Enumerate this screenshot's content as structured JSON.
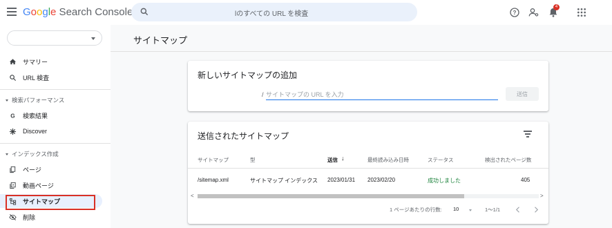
{
  "app": {
    "logo_word": "Google",
    "logo_rest": " Search Console"
  },
  "search": {
    "placeholder": "lのすべての URL を検査"
  },
  "header": {
    "notification_count": "4",
    "icons": [
      "help-icon",
      "manage-accounts-icon",
      "notifications-icon",
      "apps-icon"
    ]
  },
  "sidebar": {
    "property": "",
    "items": [
      {
        "label": "サマリー",
        "icon": "home-icon"
      },
      {
        "label": "URL 検査",
        "icon": "search-icon"
      },
      {
        "label": "検索結果",
        "icon": "google-g-icon"
      },
      {
        "label": "Discover",
        "icon": "discover-icon"
      },
      {
        "label": "ページ",
        "icon": "pages-icon"
      },
      {
        "label": "動画ページ",
        "icon": "video-pages-icon"
      },
      {
        "label": "サイトマップ",
        "icon": "sitemap-icon"
      },
      {
        "label": "削除",
        "icon": "removals-icon"
      }
    ],
    "sections": [
      "検索パフォーマンス",
      "インデックス作成"
    ]
  },
  "main": {
    "page_title": "サイトマップ",
    "add_card": {
      "title": "新しいサイトマップの追加",
      "prefix": "/",
      "input_placeholder": "サイトマップの URL を入力",
      "submit_label": "送信"
    },
    "submitted_card": {
      "title": "送信されたサイトマップ",
      "columns": [
        "サイトマップ",
        "型",
        "送信",
        "最終読み込み日時",
        "ステータス",
        "検出されたページ数"
      ],
      "sort_indicator": "↓",
      "rows": [
        {
          "sitemap": "/sitemap.xml",
          "type": "サイトマップ インデックス",
          "submitted": "2023/01/31",
          "last_read": "2023/02/20",
          "status": "成功しました",
          "discovered": "405"
        }
      ],
      "pager": {
        "rows_per_page_label": "1 ページあたりの行数:",
        "rows_per_page": "10",
        "range": "1～1/1"
      }
    }
  },
  "colors": {
    "accent": "#1a73e8",
    "success": "#188038",
    "highlight": "#d93025",
    "active_bg": "#e8f0fe"
  }
}
